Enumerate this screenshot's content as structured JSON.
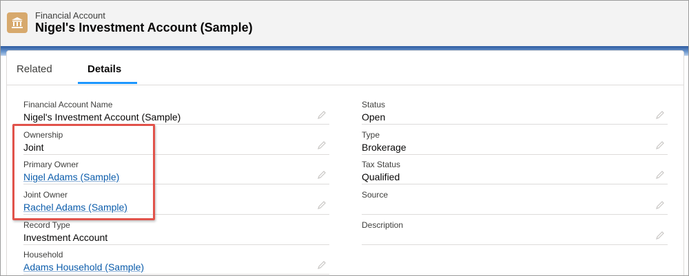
{
  "header": {
    "object_type": "Financial Account",
    "record_title": "Nigel's Investment Account (Sample)",
    "icon": "bank-icon",
    "icon_color": "#d7a96d"
  },
  "tabs": [
    {
      "label": "Related",
      "active": false
    },
    {
      "label": "Details",
      "active": true
    }
  ],
  "fields_left": [
    {
      "label": "Financial Account Name",
      "value": "Nigel's Investment Account (Sample)",
      "link": false
    },
    {
      "label": "Ownership",
      "value": "Joint",
      "link": false
    },
    {
      "label": "Primary Owner",
      "value": "Nigel Adams (Sample)",
      "link": true
    },
    {
      "label": "Joint Owner",
      "value": "Rachel Adams (Sample)",
      "link": true
    },
    {
      "label": "Record Type",
      "value": "Investment Account",
      "link": false
    },
    {
      "label": "Household",
      "value": "Adams Household (Sample)",
      "link": true
    }
  ],
  "fields_right": [
    {
      "label": "Status",
      "value": "Open",
      "link": false
    },
    {
      "label": "Type",
      "value": "Brokerage",
      "link": false
    },
    {
      "label": "Tax Status",
      "value": "Qualified",
      "link": false
    },
    {
      "label": "Source",
      "value": "",
      "link": false
    },
    {
      "label": "Description",
      "value": "",
      "link": false
    }
  ],
  "colors": {
    "link": "#0b5cab",
    "highlight": "#e1524a",
    "active_tab": "#1b96ff"
  }
}
